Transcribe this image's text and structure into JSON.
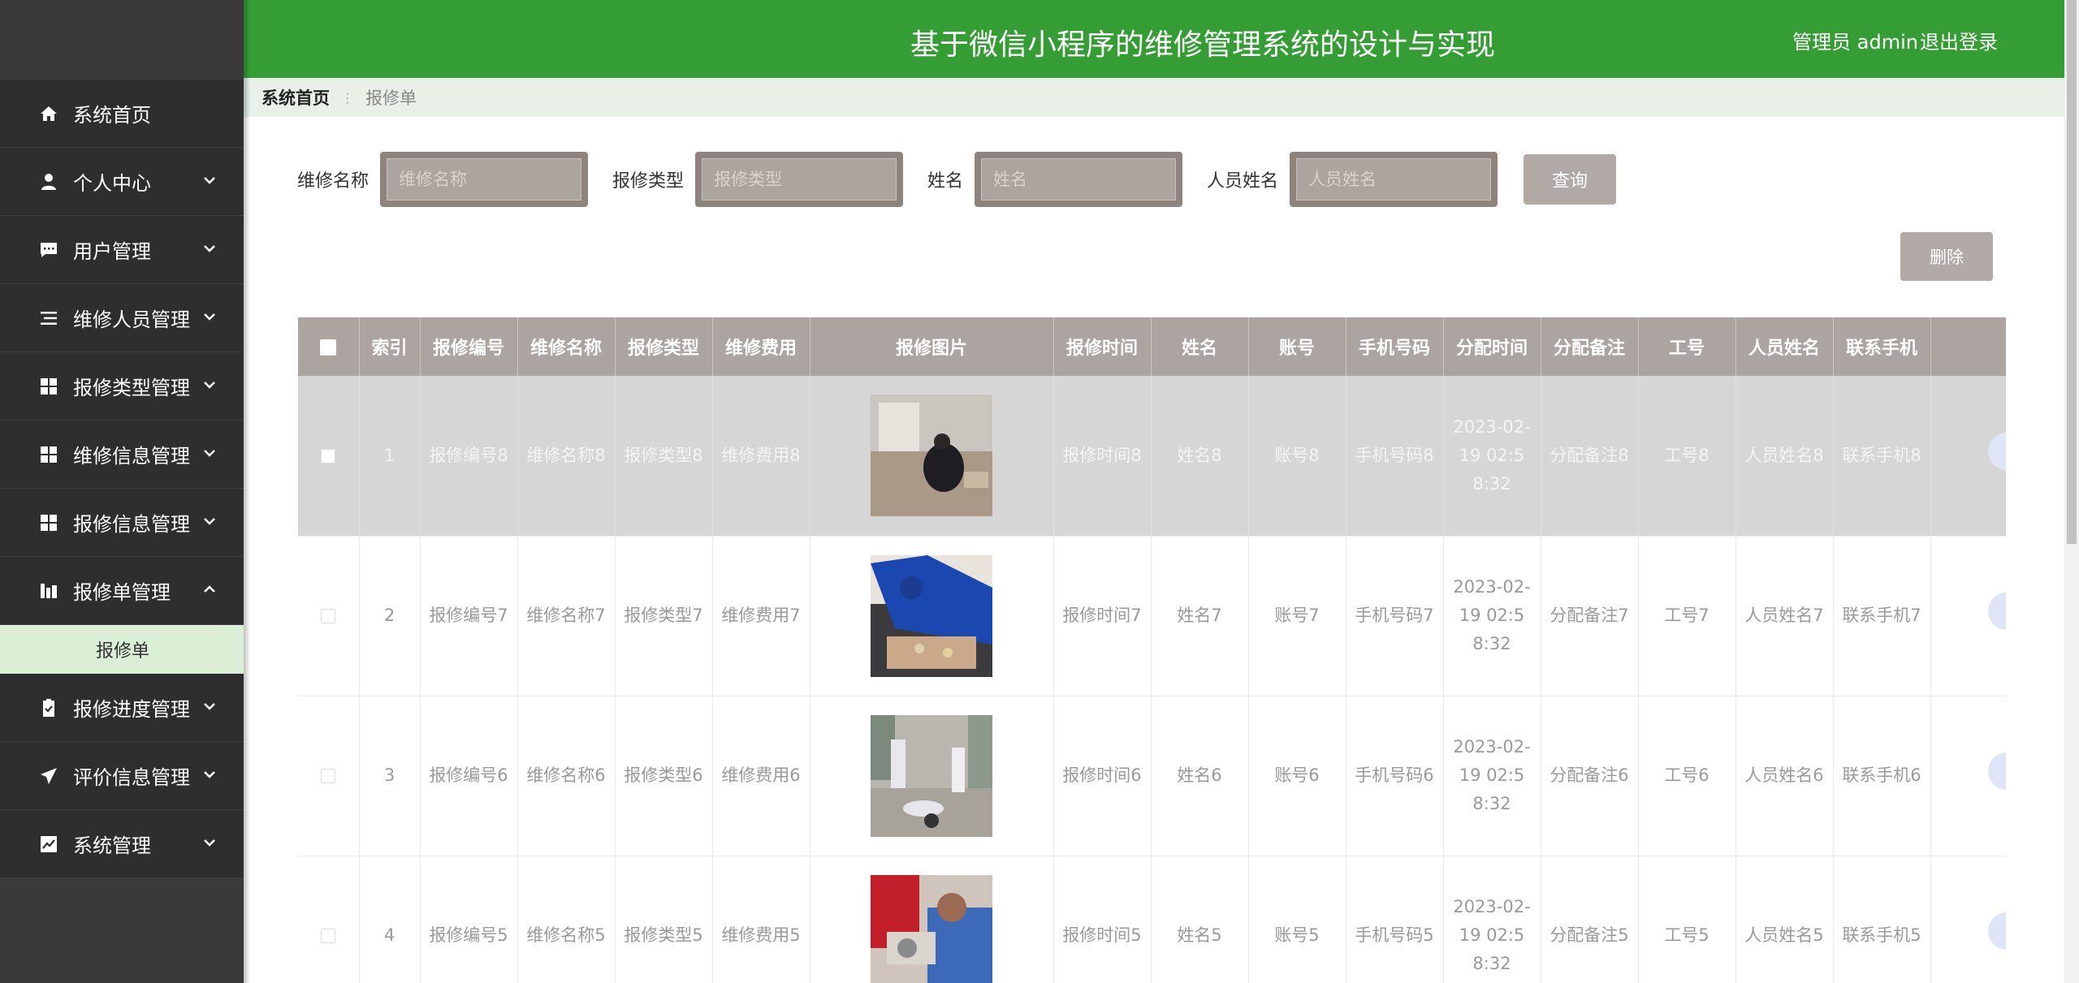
{
  "header": {
    "title": "基于微信小程序的维修管理系统的设计与实现",
    "user": "管理员 admin",
    "logout": "退出登录"
  },
  "sidebar": {
    "items": [
      {
        "label": "系统首页",
        "icon": "home-icon"
      },
      {
        "label": "个人中心",
        "icon": "user-icon"
      },
      {
        "label": "用户管理",
        "icon": "chat-icon"
      },
      {
        "label": "维修人员管理",
        "icon": "list-icon"
      },
      {
        "label": "报修类型管理",
        "icon": "grid-icon"
      },
      {
        "label": "维修信息管理",
        "icon": "grid-icon"
      },
      {
        "label": "报修信息管理",
        "icon": "grid-icon"
      },
      {
        "label": "报修单管理",
        "icon": "chart-bar-icon"
      },
      {
        "label": "报修进度管理",
        "icon": "clipboard-icon"
      },
      {
        "label": "评价信息管理",
        "icon": "send-icon"
      },
      {
        "label": "系统管理",
        "icon": "line-chart-icon"
      }
    ],
    "submenu": {
      "label": "报修单"
    }
  },
  "breadcrumb": {
    "home": "系统首页",
    "current": "报修单"
  },
  "search": {
    "fields": [
      {
        "label": "维修名称",
        "placeholder": "维修名称"
      },
      {
        "label": "报修类型",
        "placeholder": "报修类型"
      },
      {
        "label": "姓名",
        "placeholder": "姓名"
      },
      {
        "label": "人员姓名",
        "placeholder": "人员姓名"
      }
    ],
    "query_label": "查询",
    "delete_label": "删除"
  },
  "table": {
    "headers": [
      "索引",
      "报修编号",
      "维修名称",
      "报修类型",
      "维修费用",
      "报修图片",
      "报修时间",
      "姓名",
      "账号",
      "手机号码",
      "分配时间",
      "分配备注",
      "工号",
      "人员姓名",
      "联系手机"
    ],
    "rows": [
      {
        "index": "1",
        "code": "报修编号8",
        "name": "维修名称8",
        "type": "报修类型8",
        "fee": "维修费用8",
        "time": "报修时间8",
        "person": "姓名8",
        "account": "账号8",
        "phone": "手机号码8",
        "assign_time": "2023-02-19 02:58:32",
        "assign_note": "分配备注8",
        "job_no": "工号8",
        "staff_name": "人员姓名8",
        "contact": "联系手机8"
      },
      {
        "index": "2",
        "code": "报修编号7",
        "name": "维修名称7",
        "type": "报修类型7",
        "fee": "维修费用7",
        "time": "报修时间7",
        "person": "姓名7",
        "account": "账号7",
        "phone": "手机号码7",
        "assign_time": "2023-02-19 02:58:32",
        "assign_note": "分配备注7",
        "job_no": "工号7",
        "staff_name": "人员姓名7",
        "contact": "联系手机7"
      },
      {
        "index": "3",
        "code": "报修编号6",
        "name": "维修名称6",
        "type": "报修类型6",
        "fee": "维修费用6",
        "time": "报修时间6",
        "person": "姓名6",
        "account": "账号6",
        "phone": "手机号码6",
        "assign_time": "2023-02-19 02:58:32",
        "assign_note": "分配备注6",
        "job_no": "工号6",
        "staff_name": "人员姓名6",
        "contact": "联系手机6"
      },
      {
        "index": "4",
        "code": "报修编号5",
        "name": "维修名称5",
        "type": "报修类型5",
        "fee": "维修费用5",
        "time": "报修时间5",
        "person": "姓名5",
        "account": "账号5",
        "phone": "手机号码5",
        "assign_time": "2023-02-19 02:58:32",
        "assign_note": "分配备注5",
        "job_no": "工号5",
        "staff_name": "人员姓名5",
        "contact": "联系手机5"
      }
    ]
  },
  "colors": {
    "header_green": "#349e34",
    "sidebar_dark": "#2e2e2e",
    "submenu_active": "#dbefd6",
    "table_header": "#aca4a0",
    "input_frame": "#8f847d"
  }
}
